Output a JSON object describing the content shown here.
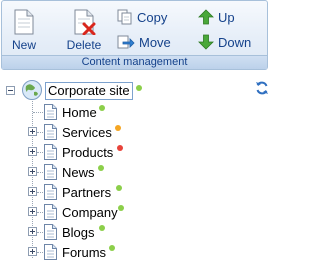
{
  "toolbar": {
    "new_label": "New",
    "delete_label": "Delete",
    "copy_label": "Copy",
    "move_label": "Move",
    "up_label": "Up",
    "down_label": "Down",
    "group_label": "Content management",
    "icons": {
      "new": "new-page-icon",
      "delete": "delete-page-icon",
      "copy": "copy-icon",
      "move": "move-icon",
      "up": "arrow-up-icon",
      "down": "arrow-down-icon"
    }
  },
  "tree": {
    "root": {
      "label": "Corporate site",
      "status_color": "#8ccf4a",
      "icon": "globe-icon",
      "expanded": true
    },
    "children": [
      {
        "label": "Home",
        "status_color": "#8ccf4a",
        "has_children": false
      },
      {
        "label": "Services",
        "status_color": "#f5a623",
        "has_children": true
      },
      {
        "label": "Products",
        "status_color": "#e8433a",
        "has_children": true
      },
      {
        "label": "News",
        "status_color": "#8ccf4a",
        "has_children": true
      },
      {
        "label": "Partners",
        "status_color": "#8ccf4a",
        "has_children": true
      },
      {
        "label": "Company",
        "status_color": "#8ccf4a",
        "has_children": true
      },
      {
        "label": "Blogs",
        "status_color": "#8ccf4a",
        "has_children": true
      },
      {
        "label": "Forums",
        "status_color": "#8ccf4a",
        "has_children": true
      }
    ],
    "refresh_icon": "refresh-icon"
  }
}
